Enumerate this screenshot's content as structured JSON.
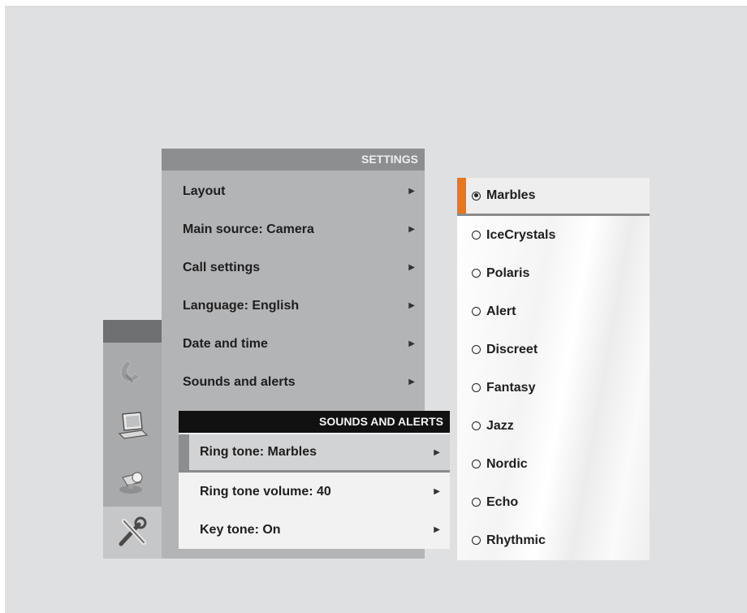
{
  "settings": {
    "title": "SETTINGS",
    "items": [
      {
        "label": "Layout"
      },
      {
        "label": "Main source: Camera"
      },
      {
        "label": "Call settings"
      },
      {
        "label": "Language: English"
      },
      {
        "label": "Date and time"
      },
      {
        "label": "Sounds and alerts"
      }
    ]
  },
  "sounds": {
    "title": "SOUNDS AND ALERTS",
    "items": [
      {
        "label": "Ring tone: Marbles",
        "selected": true
      },
      {
        "label": "Ring tone volume: 40"
      },
      {
        "label": "Key tone: On"
      }
    ]
  },
  "ringtones": {
    "selected": "Marbles",
    "items": [
      "Marbles",
      "IceCrystals",
      "Polaris",
      "Alert",
      "Discreet",
      "Fantasy",
      "Jazz",
      "Nordic",
      "Echo",
      "Rhythmic"
    ]
  },
  "dock": {
    "icons": [
      "phone-icon",
      "laptop-icon",
      "camera-icon",
      "tools-icon"
    ],
    "active": "tools-icon"
  },
  "colors": {
    "accent": "#e9761c",
    "settings_header": "#8d8e90",
    "sounds_header": "#111111"
  }
}
